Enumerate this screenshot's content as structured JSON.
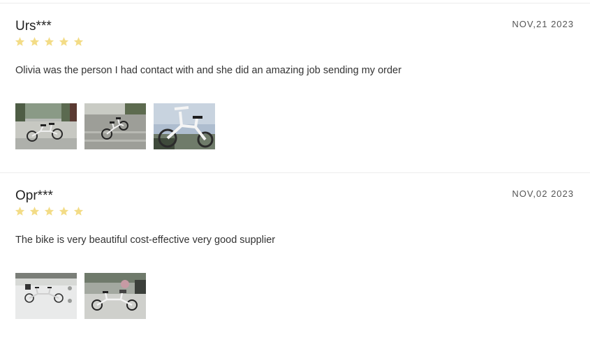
{
  "reviews": [
    {
      "name": "Urs***",
      "date": "NOV,21 2023",
      "rating": 5,
      "text": "Olivia was the person I had contact with and she did an amazing job sending my order",
      "photo_count": 3
    },
    {
      "name": "Opr***",
      "date": "NOV,02 2023",
      "rating": 5,
      "text": "The bike is very beautiful cost-effective very good supplier",
      "photo_count": 2
    }
  ],
  "colors": {
    "star": "#f3dc86",
    "divider": "#ececec"
  }
}
